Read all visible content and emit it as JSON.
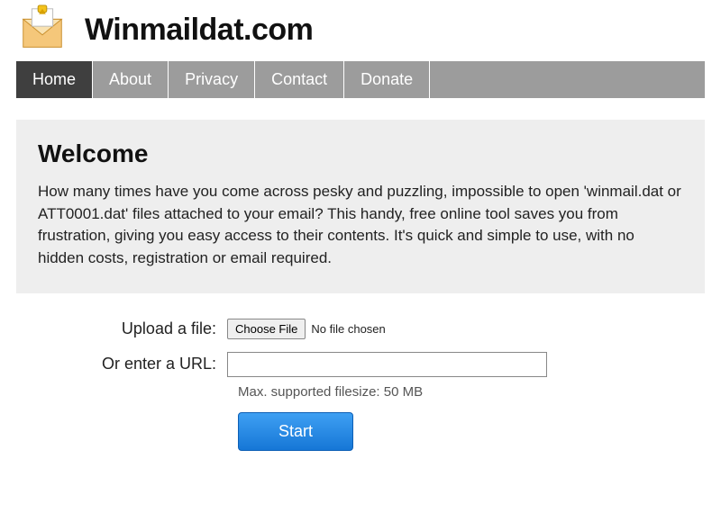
{
  "header": {
    "site_title": "Winmaildat.com",
    "logo_alt": "envelope-logo"
  },
  "nav": {
    "items": [
      {
        "label": "Home",
        "active": true
      },
      {
        "label": "About",
        "active": false
      },
      {
        "label": "Privacy",
        "active": false
      },
      {
        "label": "Contact",
        "active": false
      },
      {
        "label": "Donate",
        "active": false
      }
    ]
  },
  "welcome": {
    "title": "Welcome",
    "text": "How many times have you come across pesky and puzzling, impossible to open 'winmail.dat or ATT0001.dat' files attached to your email? This handy, free online tool saves you from frustration, giving you easy access to their contents. It's quick and simple to use, with no hidden costs, registration or email required."
  },
  "form": {
    "upload_label": "Upload a file:",
    "choose_file_label": "Choose File",
    "file_status": "No file chosen",
    "url_label": "Or enter a URL:",
    "url_value": "",
    "filesize_hint": "Max. supported filesize: 50 MB",
    "submit_label": "Start"
  },
  "colors": {
    "nav_bg": "#9c9c9c",
    "nav_active_bg": "#3f3f3f",
    "welcome_bg": "#eeeeee",
    "start_btn": "#1b82e0"
  }
}
